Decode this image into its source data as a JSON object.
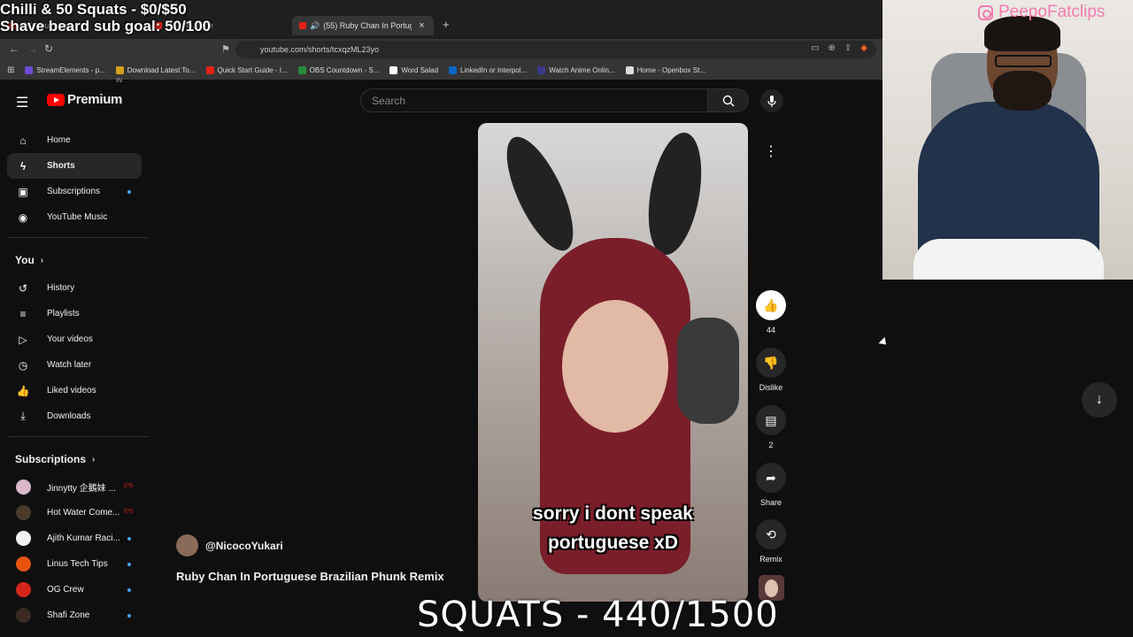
{
  "overlay": {
    "line1": "Chilli & 50 Squats - $0/$50",
    "line2": "Shave beard sub goal: 50/100",
    "squats": "SQUATS - 440/1500",
    "cam_handle": "PeepoFatclips"
  },
  "browser": {
    "tabs": [
      {
        "label": "(55) YouTube"
      },
      {
        "label": "(55) YouTube"
      },
      {
        "label": "(55) Ruby Chan In Portugue..."
      }
    ],
    "url": "youtube.com/shorts/tcxqzML23yo",
    "bookmarks": [
      {
        "label": "StreamElements - p...",
        "color": "#6e4bd6"
      },
      {
        "label": "Download Latest To...",
        "color": "#d6a21b"
      },
      {
        "label": "Quick Start Guide - I...",
        "color": "#e62117"
      },
      {
        "label": "OBS Countdown - S...",
        "color": "#2b8a3e"
      },
      {
        "label": "Word Salad",
        "color": "#ffffff"
      },
      {
        "label": "LinkedIn or Interpol...",
        "color": "#0a66c2"
      },
      {
        "label": "Watch Anime Onlin...",
        "color": "#3a3a8a"
      },
      {
        "label": "Home - Openbox St...",
        "color": "#dddddd"
      }
    ]
  },
  "youtube": {
    "logo_text": "Premium",
    "country": "IN",
    "search_placeholder": "Search",
    "sidebar_main": [
      {
        "label": "Home",
        "icon": "home-icon"
      },
      {
        "label": "Shorts",
        "icon": "shorts-icon"
      },
      {
        "label": "Subscriptions",
        "icon": "subscriptions-icon"
      },
      {
        "label": "YouTube Music",
        "icon": "music-icon"
      }
    ],
    "you_title": "You",
    "sidebar_you": [
      {
        "label": "History"
      },
      {
        "label": "Playlists"
      },
      {
        "label": "Your videos"
      },
      {
        "label": "Watch later"
      },
      {
        "label": "Liked videos"
      },
      {
        "label": "Downloads"
      }
    ],
    "subs_title": "Subscriptions",
    "subscriptions": [
      {
        "label": "Jinnytty 企鵝妹 ...",
        "color": "#d9b9c9"
      },
      {
        "label": "Hot Water Come...",
        "color": "#4a3a2a"
      },
      {
        "label": "Ajith Kumar Raci...",
        "color": "#f1f1f1"
      },
      {
        "label": "Linus Tech Tips",
        "color": "#e8540e"
      },
      {
        "label": "OG Crew",
        "color": "#d6261c"
      },
      {
        "label": "Shafi Zone",
        "color": "#3a2a22"
      }
    ],
    "video": {
      "caption_line1": "sorry i dont speak",
      "caption_line2": "portuguese xD",
      "channel": "@NicocoYukari",
      "title": "Ruby Chan In Portuguese Brazilian Phunk Remix"
    },
    "actions": {
      "likes": "44",
      "dislike": "Dislike",
      "comments": "2",
      "share": "Share",
      "remix": "Remix"
    }
  }
}
